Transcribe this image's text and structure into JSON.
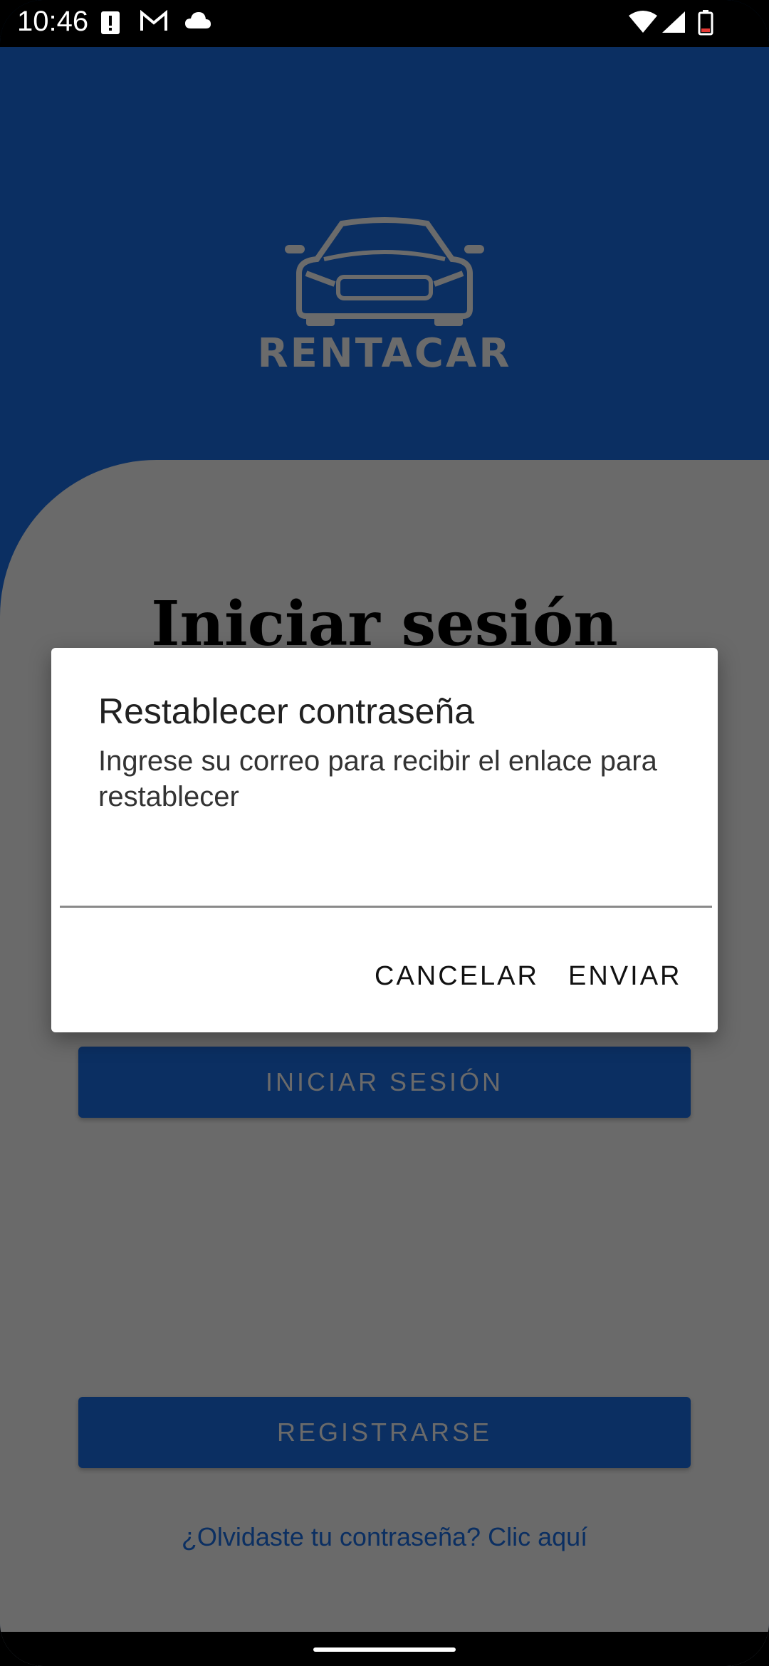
{
  "status_bar": {
    "time": "10:46",
    "icons_left": [
      "alert-icon",
      "gmail-icon",
      "cloud-icon"
    ],
    "icons_right": [
      "wifi-icon",
      "signal-icon",
      "battery-icon"
    ]
  },
  "header": {
    "logo_text": "RENTACAR"
  },
  "login": {
    "title": "Iniciar sesión",
    "login_button": "INICIAR SESIÓN",
    "register_button": "REGISTRARSE",
    "forgot_link": "¿Olvidaste tu contraseña? Clic aquí"
  },
  "dialog": {
    "title": "Restablecer contraseña",
    "message": "Ingrese su correo para recibir el enlace para restablecer",
    "input_value": "",
    "cancel_label": "CANCELAR",
    "send_label": "ENVIAR"
  },
  "colors": {
    "primary": "#0b2f62",
    "scrim_panel": "#6a6a6a",
    "dialog_bg": "#ffffff"
  }
}
